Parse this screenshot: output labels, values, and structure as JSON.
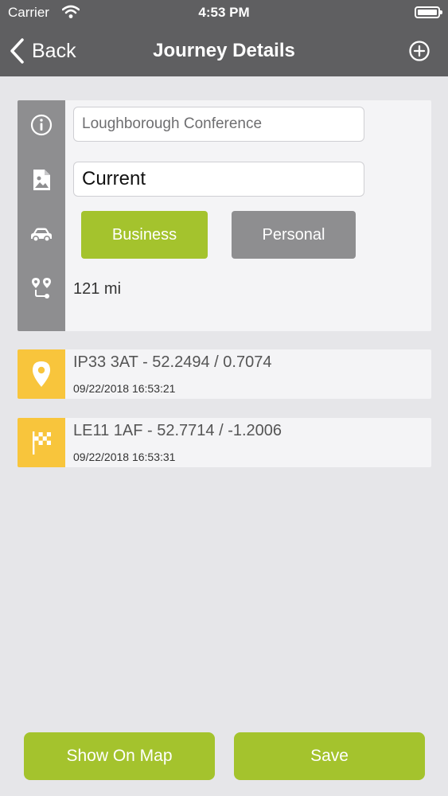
{
  "status_bar": {
    "carrier": "Carrier",
    "time": "4:53 PM"
  },
  "nav": {
    "back_label": "Back",
    "title": "Journey Details",
    "add_icon": "plus-circle-icon"
  },
  "details": {
    "journey_name": "Loughborough Conference",
    "vehicle": "Current",
    "business_label": "Business",
    "personal_label": "Personal",
    "selected_type": "Business",
    "distance": "121 mi",
    "icons": [
      "info-icon",
      "image-file-icon",
      "car-icon",
      "route-icon"
    ]
  },
  "locations": [
    {
      "title": "IP33 3AT - 52.2494 / 0.7074",
      "timestamp": "09/22/2018 16:53:21",
      "icon": "location-pin-icon"
    },
    {
      "title": "LE11 1AF - 52.7714 / -1.2006",
      "timestamp": "09/22/2018 16:53:31",
      "icon": "checkered-flag-icon"
    }
  ],
  "actions": {
    "show_on_map_label": "Show On Map",
    "save_label": "Save"
  },
  "colors": {
    "nav_bar": "#5f5f61",
    "accent_green": "#a4c32d",
    "neutral_gray": "#8e8e90",
    "location_yellow": "#f8c53c",
    "background": "#e6e6e9"
  }
}
